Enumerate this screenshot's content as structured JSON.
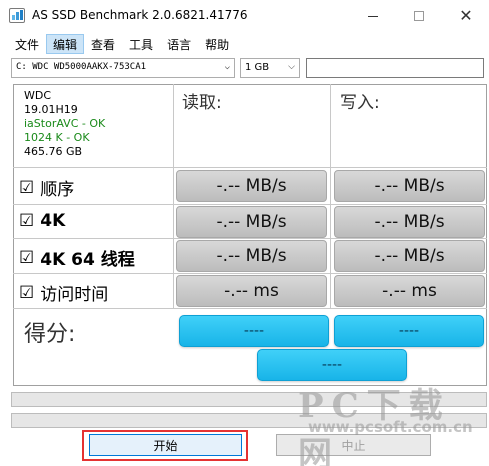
{
  "window": {
    "title": "AS SSD Benchmark 2.0.6821.41776",
    "close_glyph": "✕"
  },
  "menu": {
    "items": [
      "文件",
      "编辑",
      "查看",
      "工具",
      "语言",
      "帮助"
    ],
    "active_index": 1
  },
  "drive": {
    "selected": "C: WDC WD5000AAKX-753CA1",
    "size_selected": "1 GB",
    "arrow_glyph": "⌵"
  },
  "info": {
    "vendor": "WDC",
    "firmware": "19.01H19",
    "driver": "iaStorAVC - OK",
    "alignment": "1024 K - OK",
    "capacity": "465.76 GB"
  },
  "columns": {
    "read": "读取:",
    "write": "写入:"
  },
  "tests": [
    {
      "checkbox": "☑",
      "label": "顺序",
      "read": "-.-- MB/s",
      "write": "-.-- MB/s"
    },
    {
      "checkbox": "☑",
      "label": "4K",
      "read": "-.-- MB/s",
      "write": "-.-- MB/s"
    },
    {
      "checkbox": "☑",
      "label": "4K 64 线程",
      "read": "-.-- MB/s",
      "write": "-.-- MB/s"
    },
    {
      "checkbox": "☑",
      "label": "访问时间",
      "read": "-.-- ms",
      "write": "-.-- ms"
    }
  ],
  "score": {
    "label": "得分:",
    "read": "----",
    "write": "----",
    "total": "----"
  },
  "buttons": {
    "start": "开始",
    "abort": "中止"
  },
  "watermark": {
    "brand": "PC下载网",
    "url": "www.pcsoft.com.cn"
  },
  "colors": {
    "score_accent": "#18b4e8",
    "highlight": "#e53232",
    "ok_text": "#1a8a1a"
  }
}
